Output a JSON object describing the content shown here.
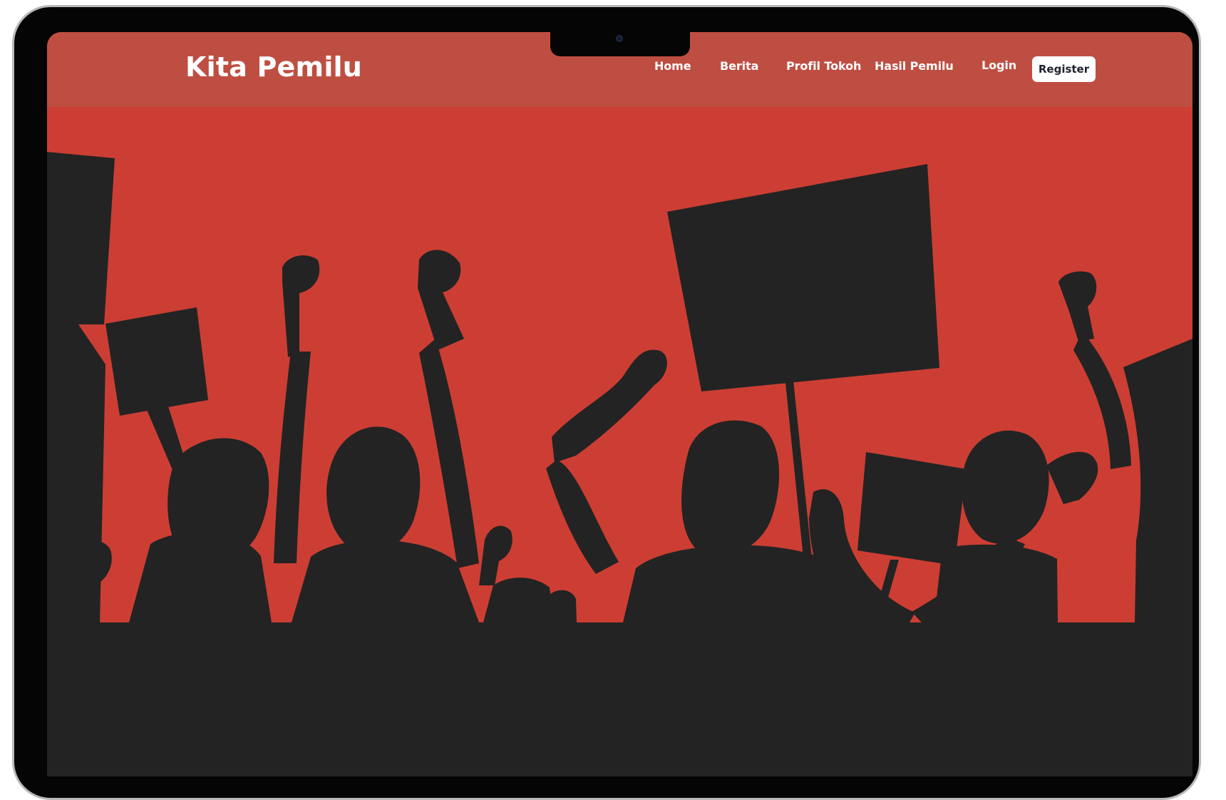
{
  "brand": {
    "title": "Kita Pemilu"
  },
  "nav": {
    "items": [
      {
        "label": "Home"
      },
      {
        "label": "Berita"
      },
      {
        "label": "Profil Tokoh"
      },
      {
        "label": "Hasil Pemilu"
      }
    ],
    "login_label": "Login",
    "register_label": "Register"
  },
  "colors": {
    "hero_background": "#cc3e33",
    "nav_background": "#be4f43",
    "silhouette": "#232323",
    "text": "#ffffff",
    "register_text": "#1f2230"
  },
  "icons": {
    "camera": "camera-icon"
  }
}
